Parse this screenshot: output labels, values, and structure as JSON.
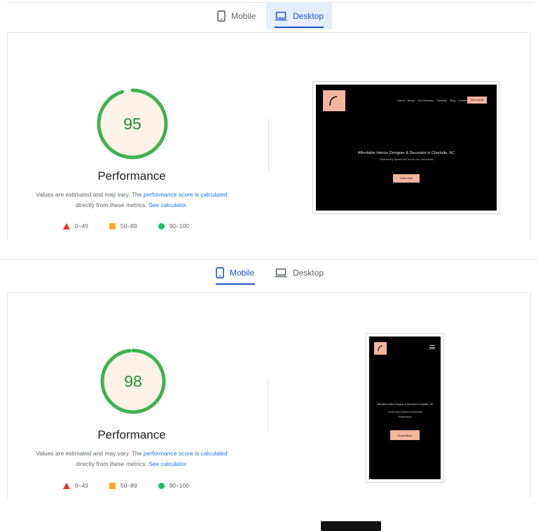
{
  "sections": [
    {
      "tabs": {
        "mobile": "Mobile",
        "desktop": "Desktop",
        "active": "desktop"
      },
      "score": 95,
      "score_fraction": 0.95,
      "title": "Performance",
      "desc_prefix": "Values are estimated and may vary. The ",
      "desc_link1": "performance score is calculated",
      "desc_mid": "directly from these metrics. ",
      "desc_link2": "See calculator.",
      "legend": {
        "fail": "0–49",
        "average": "50–89",
        "pass": "90–100"
      },
      "preview": {
        "nav": [
          "Home",
          "About",
          "Our Services",
          "Portfolio",
          "Blog",
          "Contact"
        ],
        "cta": "Get a Quote",
        "headline": "Affordable Interior Designer & Decorator in Charlotte, NC",
        "subline": "Transforming Spaces Into Homes Into Sanctuaries",
        "button": "Learn more"
      }
    },
    {
      "tabs": {
        "mobile": "Mobile",
        "desktop": "Desktop",
        "active": "mobile"
      },
      "score": 98,
      "score_fraction": 0.98,
      "title": "Performance",
      "desc_prefix": "Values are estimated and may vary. The ",
      "desc_link1": "performance score is calculated",
      "desc_mid": "directly from these metrics. ",
      "desc_link2": "See calculator.",
      "legend": {
        "fail": "0–49",
        "average": "50–89",
        "pass": "90–100"
      },
      "preview": {
        "headline": "Affordable Interior Designer & Decorator in Charlotte, NC",
        "subline": "Transforming Spaces Into Beautiful",
        "subline2": "Masterpieces",
        "button": "Know More"
      }
    }
  ],
  "colors": {
    "accent": "#1a56c4",
    "pass": "#0cce6b",
    "average": "#ffa400",
    "fail": "#ff4e42",
    "peach": "#f4b59f"
  }
}
